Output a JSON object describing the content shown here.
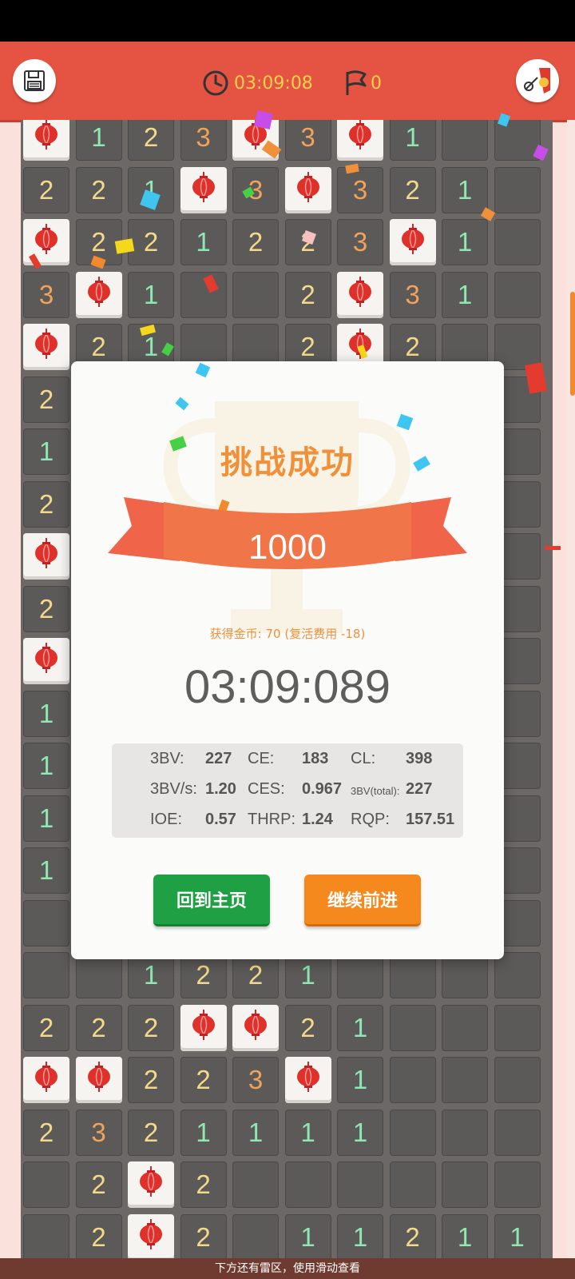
{
  "header": {
    "timer": "03:09:08",
    "flags": "0"
  },
  "board": {
    "rows": [
      [
        "M",
        "1",
        "2",
        "3",
        "M",
        "3",
        "M",
        "1",
        "",
        ""
      ],
      [
        "2",
        "2",
        "1",
        "M",
        "3",
        "M",
        "3",
        "2",
        "1",
        ""
      ],
      [
        "M",
        "2",
        "2",
        "1",
        "2",
        "2",
        "3",
        "M",
        "1",
        ""
      ],
      [
        "3",
        "M",
        "1",
        "",
        "",
        "2",
        "M",
        "3",
        "1",
        ""
      ],
      [
        "M",
        "2",
        "1",
        "",
        "",
        "2",
        "M",
        "2",
        "",
        ""
      ],
      [
        "2",
        "",
        "",
        "",
        "",
        "",
        "",
        "",
        "",
        ""
      ],
      [
        "1",
        "",
        "",
        "",
        "",
        "",
        "",
        "",
        "",
        ""
      ],
      [
        "2",
        "",
        "",
        "",
        "",
        "",
        "",
        "",
        "",
        ""
      ],
      [
        "M",
        "",
        "",
        "",
        "",
        "",
        "",
        "",
        "",
        ""
      ],
      [
        "2",
        "",
        "",
        "",
        "",
        "",
        "",
        "",
        "",
        ""
      ],
      [
        "M",
        "",
        "",
        "",
        "",
        "",
        "",
        "",
        "",
        ""
      ],
      [
        "1",
        "",
        "",
        "",
        "",
        "",
        "",
        "",
        "",
        ""
      ],
      [
        "1",
        "",
        "",
        "",
        "",
        "",
        "",
        "",
        "",
        ""
      ],
      [
        "1",
        "",
        "",
        "",
        "",
        "",
        "",
        "",
        "",
        ""
      ],
      [
        "1",
        "",
        "",
        "",
        "",
        "",
        "",
        "",
        "",
        ""
      ],
      [
        "",
        "",
        "",
        "",
        "",
        "",
        "",
        "",
        "",
        ""
      ],
      [
        "",
        "",
        "1",
        "2",
        "2",
        "1",
        "",
        "",
        "",
        ""
      ],
      [
        "2",
        "2",
        "2",
        "M",
        "M",
        "2",
        "1",
        "",
        "",
        ""
      ],
      [
        "M",
        "M",
        "2",
        "2",
        "3",
        "M",
        "1",
        "",
        "",
        ""
      ],
      [
        "2",
        "3",
        "2",
        "1",
        "1",
        "1",
        "1",
        "",
        "",
        ""
      ],
      [
        "",
        "2",
        "M",
        "2",
        "",
        "",
        "",
        "",
        "",
        ""
      ],
      [
        "",
        "2",
        "M",
        "2",
        "",
        "1",
        "1",
        "2",
        "1",
        "1"
      ]
    ]
  },
  "dialog": {
    "title": "挑战成功",
    "score": "1000",
    "coins": "获得金币: 70 (复活费用 -18)",
    "time": "03:09:089",
    "stats": [
      {
        "k": "3BV:",
        "v": "227"
      },
      {
        "k": "CE:",
        "v": "183"
      },
      {
        "k": "CL:",
        "v": "398"
      },
      {
        "k": "3BV/s:",
        "v": "1.20"
      },
      {
        "k": "CES:",
        "v": "0.967"
      },
      {
        "k": "3BV(total):",
        "v": "227"
      },
      {
        "k": "IOE:",
        "v": "0.57"
      },
      {
        "k": "THRP:",
        "v": "1.24"
      },
      {
        "k": "RQP:",
        "v": "157.51"
      }
    ],
    "home_label": "回到主页",
    "continue_label": "继续前进"
  },
  "footer": {
    "hint": "下方还有雷区，使用滑动查看"
  },
  "colors": {
    "header": "#e55443",
    "accent": "#f0913a",
    "home_button": "#1fa044",
    "continue_button": "#f5891e"
  },
  "icons": [
    "save-icon",
    "clock-icon",
    "flag-icon",
    "gift-shovel-icon",
    "lantern-icon",
    "trophy-icon"
  ]
}
